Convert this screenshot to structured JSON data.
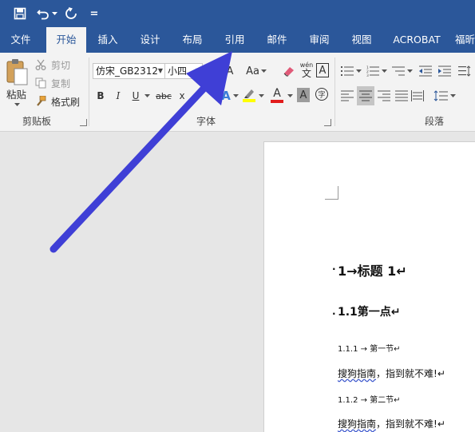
{
  "qat": {
    "customize_glyph": "="
  },
  "tabs": [
    {
      "label": "文件"
    },
    {
      "label": "开始"
    },
    {
      "label": "插入"
    },
    {
      "label": "设计"
    },
    {
      "label": "布局"
    },
    {
      "label": "引用"
    },
    {
      "label": "邮件"
    },
    {
      "label": "审阅"
    },
    {
      "label": "视图"
    },
    {
      "label": "ACROBAT"
    },
    {
      "label": "福昕"
    }
  ],
  "clipboard": {
    "paste_label": "粘贴",
    "cut_label": "剪切",
    "copy_label": "复制",
    "format_painter_label": "格式刷",
    "group_label": "剪贴板"
  },
  "font": {
    "font_name": "仿宋_GB2312",
    "font_size": "小四",
    "aa_label": "Aa",
    "phonetic_top": "wén",
    "phonetic_bottom": "文",
    "border_char": "A",
    "bold": "B",
    "italic": "I",
    "underline": "U",
    "strike": "abc",
    "subscript": "x",
    "group_label": "字体"
  },
  "paragraph": {
    "group_label": "段落"
  },
  "document": {
    "heading1": "1→标题 1↵",
    "heading2": "1.1第一点↵",
    "heading3a": "1.1.1 → 第一节↵",
    "body1_wavy": "搜狗指南",
    "body1_rest": "，指到就不难!↵",
    "heading3b": "1.1.2 → 第二节↵",
    "body2_wavy": "搜狗指南",
    "body2_rest": "，指到就不难!↵"
  },
  "colors": {
    "ribbon_blue": "#2b579a",
    "arrow": "#3f3fd6",
    "highlight_yellow": "#ffff00",
    "font_red": "#e21c1c"
  }
}
